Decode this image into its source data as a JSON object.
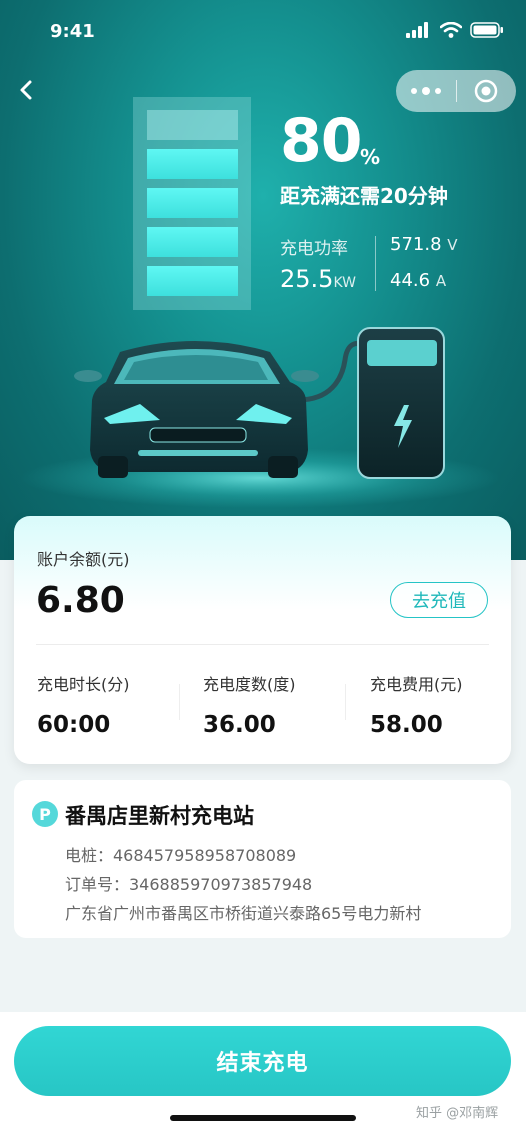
{
  "status_bar": {
    "time": "9:41"
  },
  "nav": {
    "back_icon": "chevron-left-icon",
    "more_icon": "ellipsis-icon",
    "close_icon": "target-icon"
  },
  "charging": {
    "percent": "80",
    "percent_unit": "%",
    "remaining_text": "距充满还需20分钟",
    "power_label": "充电功率",
    "power_value": "25.5",
    "power_unit": "KW",
    "voltage_value": "571.8",
    "voltage_unit": "V",
    "current_value": "44.6",
    "current_unit": "A",
    "battery_level": 0.8
  },
  "balance": {
    "label": "账户余额(元)",
    "value": "6.80",
    "topup_label": "去充值",
    "stats": [
      {
        "label": "充电时长(分)",
        "value": "60:00"
      },
      {
        "label": "充电度数(度)",
        "value": "36.00"
      },
      {
        "label": "充电费用(元)",
        "value": "58.00"
      }
    ]
  },
  "station": {
    "badge": "P",
    "name": "番禺店里新村充电站",
    "pile": "电桩：468457958958708089",
    "order": "订单号：346885970973857948",
    "address": "广东省广州市番禺区市桥街道兴泰路65号电力新村"
  },
  "action": {
    "end_label": "结束充电"
  },
  "watermark": "知乎 @邓南辉",
  "colors": {
    "accent": "#27c6c5",
    "hero": "#14908f",
    "battery_lit": "#4ff0ee"
  }
}
